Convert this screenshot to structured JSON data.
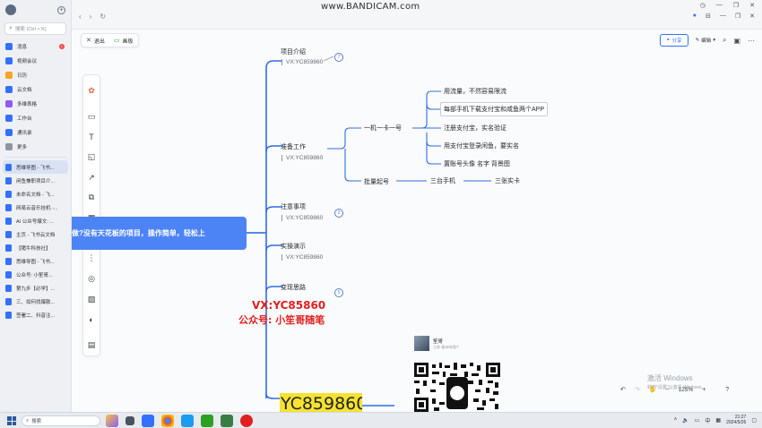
{
  "recorder_watermark": "www.BANDICAM.com",
  "sidebar": {
    "search_placeholder": "搜索 (Ctrl + K)",
    "messages_badge": "1",
    "nav_items": [
      {
        "label": "消息",
        "color": "#3370ff"
      },
      {
        "label": "视频会议",
        "color": "#3370ff"
      },
      {
        "label": "日历",
        "color": "#f5a623"
      },
      {
        "label": "云文档",
        "color": "#3370ff"
      },
      {
        "label": "多维表格",
        "color": "#8f5af7"
      },
      {
        "label": "工作台",
        "color": "#3370ff"
      },
      {
        "label": "通讯录",
        "color": "#3370ff"
      },
      {
        "label": "更多",
        "color": "#8f959e"
      }
    ],
    "docs": [
      "思维导图 - 飞书...",
      "闲鱼兼职项目介...",
      "未命名文档 - 飞...",
      "网易云音乐挂机 -...",
      "AI 公众号爆文: ...",
      "主页 - 飞书云文档",
      "【猪牛科技社】",
      "思维导图 - 飞书...",
      "公众号: 小笙哥...",
      "第九步【必学】...",
      "三、如何找爆款...",
      "签署二、抖音注..."
    ]
  },
  "toolbar": {
    "exit_label": "退出",
    "panel_label": "画板",
    "share_label": "分享",
    "edit_label": "编辑"
  },
  "mindmap": {
    "root_label": "做?没有天花板的项目，操作简单，轻松上",
    "branches": [
      {
        "label": "项目介绍",
        "sub": "VX:YC859860",
        "count": "7"
      },
      {
        "label": "准备工作",
        "sub": "VX:YC859860"
      },
      {
        "label": "注意事项",
        "sub": "VX:YC859860",
        "count": "2"
      },
      {
        "label": "实操演示",
        "sub": "VX:YC859860"
      },
      {
        "label": "变现思路",
        "count": "5"
      }
    ],
    "prep": {
      "level1": "一机一卡一号",
      "steps": [
        "用流量，不然容易限流",
        "每部手机下载支付宝和咸鱼两个APP",
        "注册支付宝，实名验证",
        "用支付宝登录闲鱼，要实名",
        "置账号头像 名字 背景图"
      ],
      "batch": "批量起号",
      "batch_child1": "三台手机",
      "batch_child2": "三张实卡"
    },
    "overlay_vx": "VX:YC85860",
    "overlay_gzh": "公众号: 小笙哥随笔",
    "profile_name": "笙哥",
    "profile_sub": "江苏 泰州市用户",
    "yellow_text": "YC859860"
  },
  "windows_watermark": {
    "line1": "激活 Windows",
    "line2": "转到\"设置\"以激活 Windows。"
  },
  "zoom_level": "125%",
  "taskbar": {
    "search_label": "搜索",
    "time": "21:27",
    "date": "2024/5/26",
    "ime": "中"
  }
}
